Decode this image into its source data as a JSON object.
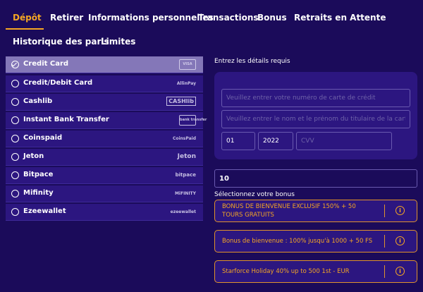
{
  "tabs": [
    {
      "label": "Dépôt",
      "active": true
    },
    {
      "label": "Retirer"
    },
    {
      "label": "Informations personnelles"
    },
    {
      "label": "Transactions"
    },
    {
      "label": "Bonus"
    },
    {
      "label": "Retraits en Attente"
    },
    {
      "label": "Historique des paris"
    },
    {
      "label": "Limites"
    }
  ],
  "methods": [
    {
      "label": "Credit Card",
      "selected": true,
      "logo": "VISA"
    },
    {
      "label": "Credit/Debit Card",
      "logo": "AllinPay"
    },
    {
      "label": "Cashlib",
      "logo": "CASHlib"
    },
    {
      "label": "Instant Bank Transfer",
      "logo": "bank transfer"
    },
    {
      "label": "Coinspaid",
      "logo": "CoinsPaid"
    },
    {
      "label": "Jeton",
      "logo": "Jeton"
    },
    {
      "label": "Bitpace",
      "logo": "bitpace"
    },
    {
      "label": "Mifinity",
      "logo": "MiFINITY"
    },
    {
      "label": "Ezeewallet",
      "logo": "ezeewallet"
    }
  ],
  "form": {
    "title": "Entrez les détails requis",
    "card_number_placeholder": "Veuillez entrer votre numéro de carte de crédit",
    "holder_placeholder": "Veuillez entrer le nom et le prénom du titulaire de la carte",
    "month": "01",
    "year": "2022",
    "cvv_placeholder": "CVV",
    "amount": "10"
  },
  "bonus": {
    "title": "Sélectionnez votre bonus",
    "items": [
      {
        "text": "BONUS DE BIENVENUE EXCLUSIF 150% + 50 TOURS GRATUITS"
      },
      {
        "text": "Bonus de bienvenue : 100% jusqu'à 1000 + 50 FS"
      },
      {
        "text": "Starforce Holiday 40% up to 500 1st - EUR"
      }
    ]
  },
  "colors": {
    "background": "#1b0b5a",
    "panel": "#2c1680",
    "accent": "#f5a623",
    "selected": "#8477b8"
  }
}
